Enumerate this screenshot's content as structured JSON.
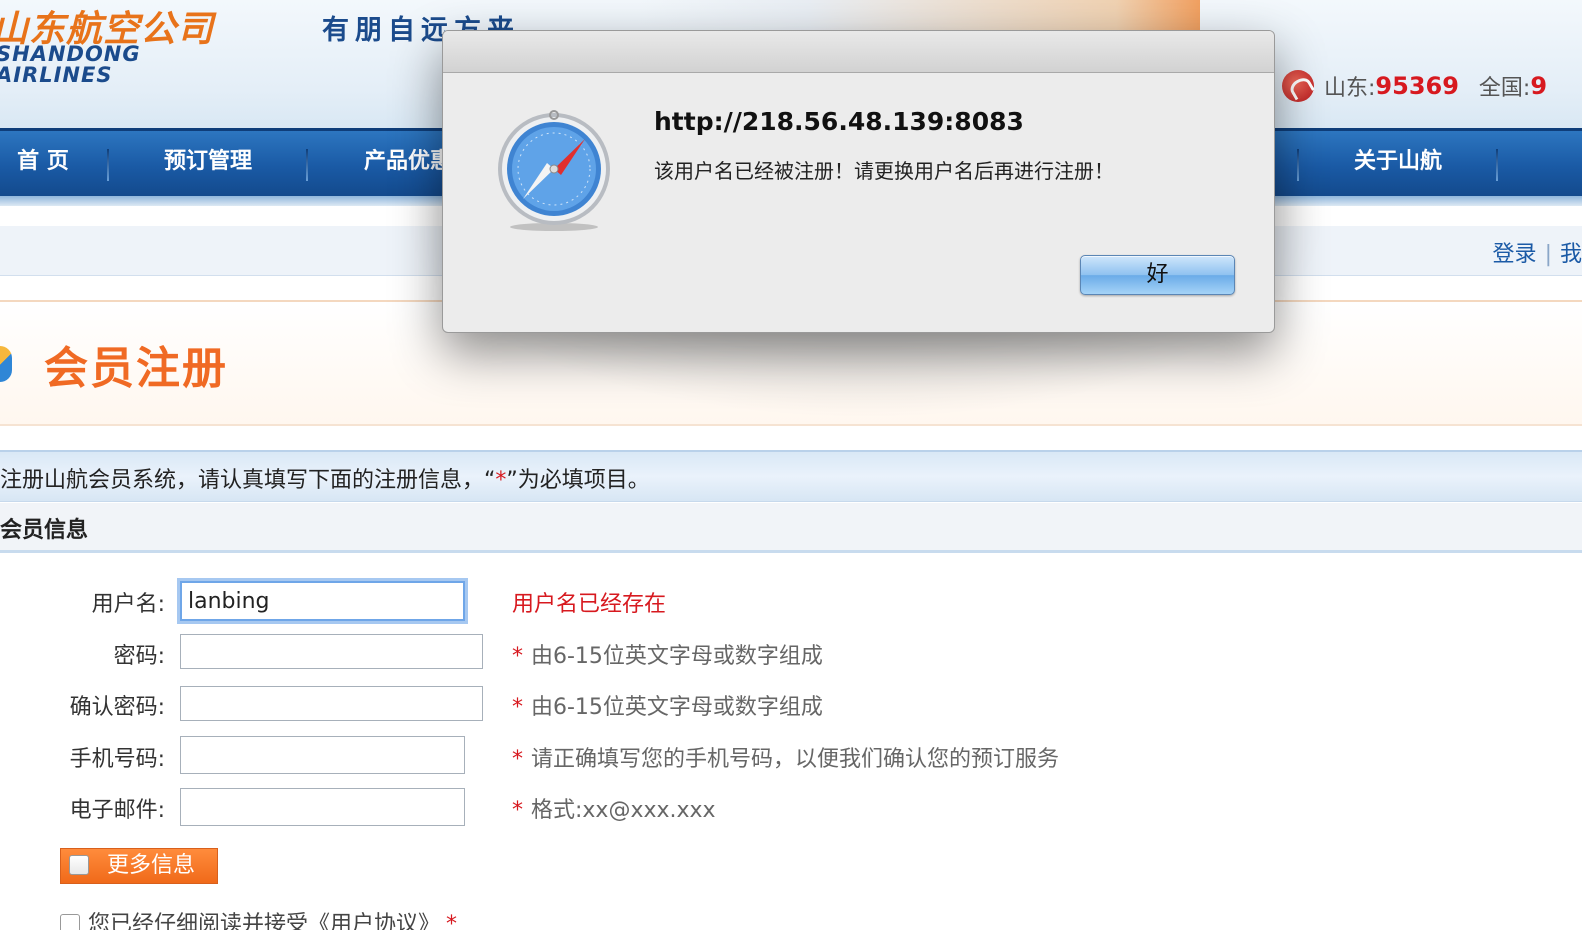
{
  "header": {
    "logo_cn": "山东航空公司",
    "logo_en_line1": "SHANDONG",
    "logo_en_line2": "AIRLINES",
    "slogan": "有朋自远方来",
    "hotline": {
      "label_province": "山东:",
      "number_province": "95369",
      "label_national": "全国:",
      "number_national": "9"
    }
  },
  "nav": {
    "items": [
      {
        "label": "首 页"
      },
      {
        "label": "预订管理"
      },
      {
        "label": "产品优惠"
      },
      {
        "label": "关于山航"
      }
    ]
  },
  "subbar": {
    "login": "登录",
    "separator": "|",
    "register": "我"
  },
  "page": {
    "title": "会员注册",
    "notice_prefix": "注册山航会员系统，请认真填写下面的注册信息，“",
    "notice_star": "*",
    "notice_suffix": "”为必填项目。",
    "section_title": "会员信息"
  },
  "form": {
    "username": {
      "label": "用户名:",
      "value": "lanbing",
      "error": "用户名已经存在"
    },
    "password": {
      "label": "密码:",
      "value": "",
      "hint": "由6-15位英文字母或数字组成"
    },
    "confirm_password": {
      "label": "确认密码:",
      "value": "",
      "hint": "由6-15位英文字母或数字组成"
    },
    "mobile": {
      "label": "手机号码:",
      "value": "",
      "hint": "请正确填写您的手机号码，以便我们确认您的预订服务"
    },
    "email": {
      "label": "电子邮件:",
      "value": "",
      "hint": "格式:xx@xxx.xxx"
    },
    "required_star": "*",
    "more_info_label": "更多信息",
    "agree_text": "您已经仔细阅读并接受《用户协议》"
  },
  "dialog": {
    "title": "http://218.56.48.139:8083",
    "message": "该用户名已经被注册！请更换用户名后再进行注册！",
    "ok_label": "好",
    "icon": "safari-compass-icon"
  },
  "colors": {
    "nav_blue": "#1a5aa5",
    "title_orange": "#f06a24",
    "error_red": "#d7191f",
    "link_blue": "#1b5aa6"
  }
}
